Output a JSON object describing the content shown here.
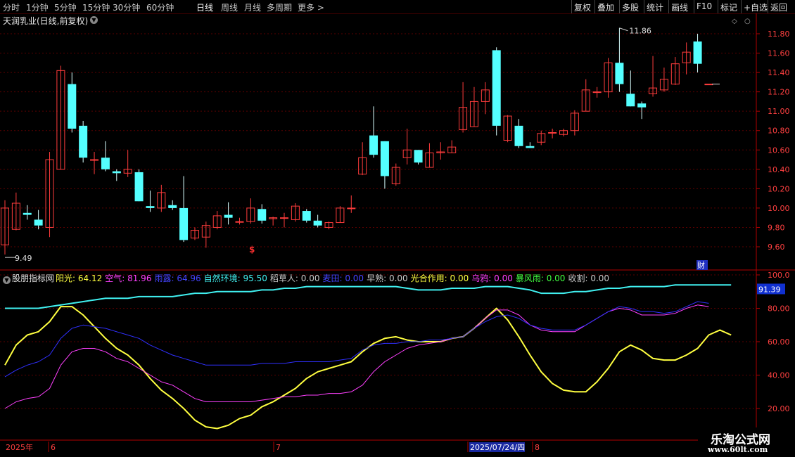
{
  "toolbar": {
    "left_items": [
      "分时",
      "1分钟",
      "5分钟",
      "15分钟",
      "30分钟",
      "60分钟",
      "日线",
      "周线",
      "月线",
      "多周期",
      "更多 >"
    ],
    "active": "日线",
    "right_items": [
      "复权",
      "叠加",
      "多股",
      "统计",
      "画线",
      "F10",
      "标记",
      "+自选",
      "返回"
    ]
  },
  "main_title": "天润乳业(日线,前复权)",
  "colors": {
    "up": "#ff3c3c",
    "down": "#54ffff",
    "axis": "#b00000",
    "grid": "#5a0000",
    "yang": "#ffff40",
    "kong": "#ff40ff",
    "yulu": "#4040ff",
    "ziran": "#40f0f0"
  },
  "indicator": {
    "name": "股朋指标网",
    "items": [
      {
        "label": "阳光:",
        "value": "64.12",
        "color": "#ffff40"
      },
      {
        "label": "空气:",
        "value": "81.96",
        "color": "#ff40ff"
      },
      {
        "label": "雨露:",
        "value": "64.96",
        "color": "#4444ff"
      },
      {
        "label": "自然环境:",
        "value": "95.50",
        "color": "#40f0f0"
      },
      {
        "label": "稻草人:",
        "value": "0.00",
        "color": "#c8c8c8"
      },
      {
        "label": "麦田:",
        "value": "0.00",
        "color": "#4444ff"
      },
      {
        "label": "早熟:",
        "value": "0.00",
        "color": "#c8c8c8"
      },
      {
        "label": "光合作用:",
        "value": "0.00",
        "color": "#ffff40"
      },
      {
        "label": "乌鸦:",
        "value": "0.00",
        "color": "#ff40ff"
      },
      {
        "label": "暴风雨:",
        "value": "0.00",
        "color": "#40ff40"
      },
      {
        "label": "收割:",
        "value": "0.00",
        "color": "#c8c8c8"
      }
    ]
  },
  "chart_data": [
    {
      "type": "candlestick",
      "ylim": [
        9.49,
        11.9
      ],
      "price_ticks": [
        "11.80",
        "11.60",
        "11.40",
        "11.20",
        "11.00",
        "10.80",
        "10.60",
        "10.40",
        "10.20",
        "10.00",
        "9.80",
        "9.60"
      ],
      "high_label": "11.86",
      "low_label": "9.49",
      "marker_s": "$",
      "marker_cai": "财",
      "candles": [
        {
          "o": 9.62,
          "c": 10.0,
          "h": 10.08,
          "l": 9.52
        },
        {
          "o": 9.78,
          "c": 10.05,
          "h": 10.16,
          "l": 9.77
        },
        {
          "o": 9.95,
          "c": 9.93,
          "h": 10.03,
          "l": 9.88
        },
        {
          "o": 9.88,
          "c": 9.82,
          "h": 9.98,
          "l": 9.78
        },
        {
          "o": 9.8,
          "c": 10.5,
          "h": 10.58,
          "l": 9.7
        },
        {
          "o": 10.4,
          "c": 11.42,
          "h": 11.47,
          "l": 10.4
        },
        {
          "o": 11.28,
          "c": 10.82,
          "h": 11.4,
          "l": 10.78
        },
        {
          "o": 10.85,
          "c": 10.52,
          "h": 10.9,
          "l": 10.47
        },
        {
          "o": 10.5,
          "c": 10.5,
          "h": 10.58,
          "l": 10.35
        },
        {
          "o": 10.52,
          "c": 10.4,
          "h": 10.69,
          "l": 10.38
        },
        {
          "o": 10.38,
          "c": 10.36,
          "h": 10.4,
          "l": 10.28
        },
        {
          "o": 10.36,
          "c": 10.4,
          "h": 10.6,
          "l": 10.32
        },
        {
          "o": 10.37,
          "c": 10.07,
          "h": 10.4,
          "l": 10.07
        },
        {
          "o": 10.02,
          "c": 10.0,
          "h": 10.18,
          "l": 9.96
        },
        {
          "o": 10.0,
          "c": 10.16,
          "h": 10.24,
          "l": 9.96
        },
        {
          "o": 10.03,
          "c": 10.0,
          "h": 10.08,
          "l": 9.98
        },
        {
          "o": 10.0,
          "c": 9.67,
          "h": 10.33,
          "l": 9.65
        },
        {
          "o": 9.69,
          "c": 9.77,
          "h": 9.8,
          "l": 9.67
        },
        {
          "o": 9.7,
          "c": 9.82,
          "h": 9.86,
          "l": 9.59
        },
        {
          "o": 9.8,
          "c": 9.92,
          "h": 9.97,
          "l": 9.78
        },
        {
          "o": 9.93,
          "c": 9.9,
          "h": 10.06,
          "l": 9.83
        },
        {
          "o": 9.86,
          "c": 9.86,
          "h": 9.9,
          "l": 9.83
        },
        {
          "o": 9.86,
          "c": 10.0,
          "h": 10.1,
          "l": 9.84
        },
        {
          "o": 9.99,
          "c": 9.87,
          "h": 10.04,
          "l": 9.84
        },
        {
          "o": 9.89,
          "c": 9.9,
          "h": 9.91,
          "l": 9.82
        },
        {
          "o": 9.9,
          "c": 9.9,
          "h": 9.95,
          "l": 9.8
        },
        {
          "o": 9.88,
          "c": 10.02,
          "h": 10.05,
          "l": 9.86
        },
        {
          "o": 9.97,
          "c": 9.87,
          "h": 9.99,
          "l": 9.85
        },
        {
          "o": 9.87,
          "c": 9.82,
          "h": 9.93,
          "l": 9.8
        },
        {
          "o": 9.8,
          "c": 9.85,
          "h": 9.86,
          "l": 9.78
        },
        {
          "o": 9.85,
          "c": 10.0,
          "h": 10.02,
          "l": 9.85
        },
        {
          "o": 10.0,
          "c": 10.0,
          "h": 10.13,
          "l": 9.95
        },
        {
          "o": 10.35,
          "c": 10.52,
          "h": 10.68,
          "l": 10.34
        },
        {
          "o": 10.75,
          "c": 10.55,
          "h": 11.05,
          "l": 10.52
        },
        {
          "o": 10.69,
          "c": 10.33,
          "h": 10.69,
          "l": 10.2
        },
        {
          "o": 10.25,
          "c": 10.42,
          "h": 10.46,
          "l": 10.23
        },
        {
          "o": 10.52,
          "c": 10.6,
          "h": 10.82,
          "l": 10.45
        },
        {
          "o": 10.6,
          "c": 10.47,
          "h": 10.6,
          "l": 10.45
        },
        {
          "o": 10.42,
          "c": 10.57,
          "h": 10.67,
          "l": 10.42
        },
        {
          "o": 10.57,
          "c": 10.58,
          "h": 10.68,
          "l": 10.5
        },
        {
          "o": 10.57,
          "c": 10.63,
          "h": 10.7,
          "l": 10.57
        },
        {
          "o": 10.81,
          "c": 11.04,
          "h": 11.3,
          "l": 10.78
        },
        {
          "o": 10.84,
          "c": 11.1,
          "h": 11.25,
          "l": 10.84
        },
        {
          "o": 11.1,
          "c": 11.22,
          "h": 11.3,
          "l": 10.97
        },
        {
          "o": 11.63,
          "c": 10.85,
          "h": 11.66,
          "l": 10.75
        },
        {
          "o": 10.7,
          "c": 10.95,
          "h": 10.96,
          "l": 10.68
        },
        {
          "o": 10.85,
          "c": 10.64,
          "h": 10.92,
          "l": 10.62
        },
        {
          "o": 10.64,
          "c": 10.62,
          "h": 10.68,
          "l": 10.62
        },
        {
          "o": 10.68,
          "c": 10.77,
          "h": 10.8,
          "l": 10.65
        },
        {
          "o": 10.78,
          "c": 10.78,
          "h": 10.82,
          "l": 10.72
        },
        {
          "o": 10.76,
          "c": 10.8,
          "h": 10.82,
          "l": 10.74
        },
        {
          "o": 10.8,
          "c": 10.98,
          "h": 11.01,
          "l": 10.75
        },
        {
          "o": 11.0,
          "c": 11.22,
          "h": 11.33,
          "l": 11.0
        },
        {
          "o": 11.2,
          "c": 11.2,
          "h": 11.25,
          "l": 11.14
        },
        {
          "o": 11.2,
          "c": 11.5,
          "h": 11.55,
          "l": 11.14
        },
        {
          "o": 11.5,
          "c": 11.28,
          "h": 11.86,
          "l": 11.2
        },
        {
          "o": 11.18,
          "c": 11.05,
          "h": 11.42,
          "l": 11.05
        },
        {
          "o": 11.08,
          "c": 11.04,
          "h": 11.1,
          "l": 10.92
        },
        {
          "o": 11.18,
          "c": 11.24,
          "h": 11.57,
          "l": 11.15
        },
        {
          "o": 11.22,
          "c": 11.33,
          "h": 11.45,
          "l": 11.2
        },
        {
          "o": 11.28,
          "c": 11.49,
          "h": 11.56,
          "l": 11.27
        },
        {
          "o": 11.5,
          "c": 11.61,
          "h": 11.71,
          "l": 11.38
        },
        {
          "o": 11.72,
          "c": 11.49,
          "h": 11.8,
          "l": 11.4
        },
        {
          "o": 11.28,
          "c": 11.28,
          "h": 11.28,
          "l": 11.28
        }
      ]
    },
    {
      "type": "line",
      "ylim": [
        10,
        100
      ],
      "y_ticks": [
        "100.0",
        "80.00",
        "60.00",
        "40.00",
        "20.00"
      ],
      "current_label": "91.39",
      "series": [
        {
          "name": "阳光",
          "values": [
            46,
            58,
            64,
            66,
            72,
            81,
            81,
            76,
            69,
            62,
            56,
            52,
            46,
            38,
            31,
            26,
            20,
            13,
            9,
            8,
            10,
            14,
            16,
            21,
            24,
            28,
            32,
            38,
            42,
            44,
            46,
            48,
            54,
            59,
            62,
            63,
            61,
            60,
            60,
            60,
            62,
            63,
            68,
            74,
            80,
            73,
            63,
            52,
            42,
            35,
            31,
            30,
            30,
            36,
            44,
            54,
            58,
            55,
            50,
            49,
            49,
            52,
            56,
            64,
            67,
            64
          ]
        },
        {
          "name": "空气",
          "values": [
            20,
            24,
            26,
            27,
            32,
            46,
            54,
            56,
            56,
            54,
            50,
            48,
            44,
            40,
            36,
            34,
            30,
            26,
            24,
            24,
            24,
            24,
            24,
            25,
            26,
            27,
            27,
            28,
            28,
            29,
            29,
            30,
            34,
            42,
            48,
            52,
            56,
            58,
            59,
            60,
            62,
            63,
            68,
            74,
            79,
            79,
            76,
            70,
            67,
            66,
            66,
            66,
            70,
            74,
            78,
            80,
            79,
            76,
            76,
            76,
            77,
            80,
            82,
            81
          ]
        },
        {
          "name": "雨露",
          "values": [
            39,
            43,
            46,
            48,
            52,
            62,
            68,
            70,
            69,
            68,
            66,
            64,
            62,
            58,
            55,
            52,
            50,
            48,
            46,
            46,
            46,
            46,
            46,
            47,
            47,
            47,
            48,
            48,
            48,
            48,
            49,
            50,
            55,
            58,
            59,
            59,
            60,
            60,
            61,
            61,
            62,
            63,
            68,
            72,
            75,
            76,
            74,
            70,
            68,
            67,
            67,
            67,
            70,
            74,
            78,
            81,
            80,
            78,
            78,
            77,
            78,
            81,
            84,
            83
          ]
        },
        {
          "name": "自然环境",
          "values": [
            80,
            80,
            80,
            80,
            81,
            82,
            83,
            84,
            85,
            86,
            86,
            86,
            87,
            87,
            87,
            87,
            88,
            89,
            89,
            90,
            90,
            90,
            90,
            91,
            91,
            92,
            92,
            93,
            93,
            93,
            93,
            93,
            93,
            93,
            93,
            93,
            92,
            91,
            91,
            91,
            92,
            92,
            92,
            93,
            93,
            93,
            92,
            91,
            89,
            89,
            89,
            90,
            90,
            91,
            92,
            92,
            93,
            93,
            93,
            93,
            94,
            94,
            94,
            94,
            94,
            94
          ]
        }
      ]
    }
  ],
  "timeline": {
    "labels": [
      "2025年",
      "6",
      "7",
      "2025/07/24/四",
      "8"
    ]
  },
  "watermark": {
    "title": "乐淘公式网",
    "url": "www.60lt.com"
  }
}
